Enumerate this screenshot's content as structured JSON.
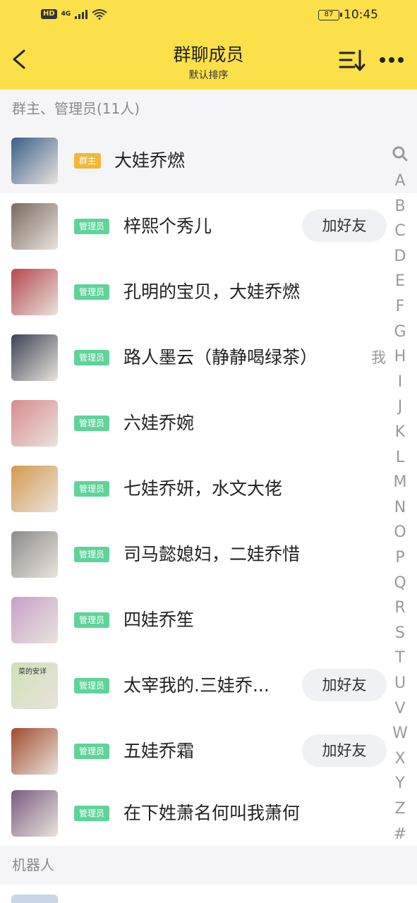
{
  "status_bar": {
    "hd": "HD",
    "network": "4G",
    "battery": "87",
    "time": "10:45"
  },
  "header": {
    "title": "群聊成员",
    "subtitle": "默认排序"
  },
  "sections": {
    "admins": "群主、管理员(11人)",
    "bots": "机器人"
  },
  "members": [
    {
      "name": "大娃乔燃",
      "role": "群主",
      "avatar": "#3a5f8a"
    },
    {
      "name": "梓熙个秀儿",
      "role": "管理员",
      "action": "加好友",
      "avatar": "#7b6a60"
    },
    {
      "name": "孔明的宝贝，大娃乔燃",
      "role": "管理员",
      "avatar": "#b5474f"
    },
    {
      "name": "路人墨云（静静喝绿茶）",
      "role": "管理员",
      "tag": "我",
      "avatar": "#3d4256"
    },
    {
      "name": "六娃乔婉",
      "role": "管理员",
      "avatar": "#d98b8e"
    },
    {
      "name": "七娃乔妍，水文大佬",
      "role": "管理员",
      "avatar": "#d49a4f"
    },
    {
      "name": "司马懿媳妇，二娃乔惜",
      "role": "管理员",
      "avatar": "#8c8c8c"
    },
    {
      "name": "四娃乔笙",
      "role": "管理员",
      "avatar": "#c7a0c9"
    },
    {
      "name": "太宰我的.三娃乔...",
      "role": "管理员",
      "action": "加好友",
      "avatar_text": "菜的安详",
      "avatar": "#cfe0b8"
    },
    {
      "name": "五娃乔霜",
      "role": "管理员",
      "action": "加好友",
      "avatar": "#a24a2e"
    },
    {
      "name": "在下姓萧名何叫我萧何",
      "role": "管理员",
      "avatar": "#7a5c80"
    }
  ],
  "index_letters": [
    "A",
    "B",
    "C",
    "D",
    "E",
    "F",
    "G",
    "H",
    "I",
    "J",
    "K",
    "L",
    "M",
    "N",
    "O",
    "P",
    "Q",
    "R",
    "S",
    "T",
    "U",
    "V",
    "W",
    "X",
    "Y",
    "Z",
    "#"
  ],
  "colors": {
    "accent_yellow": "#fbe04a",
    "owner_badge": "#f0b93a",
    "admin_badge": "#5fd39a"
  }
}
